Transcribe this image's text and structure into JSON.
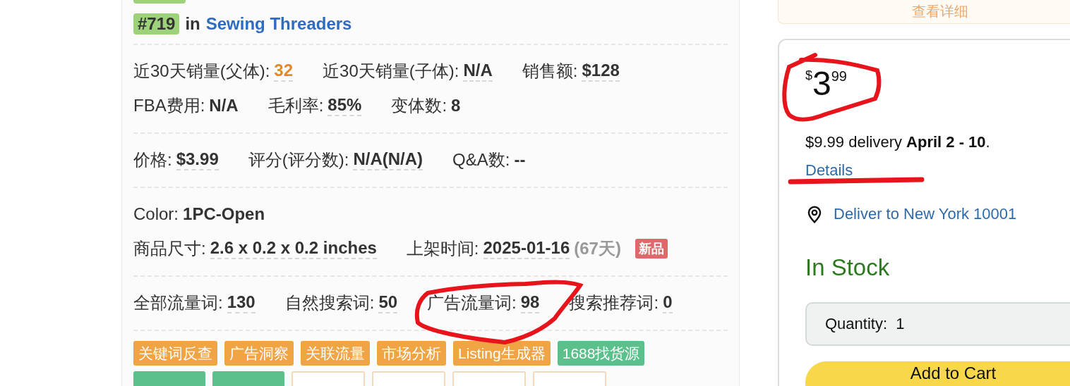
{
  "rank": {
    "badge": "#719",
    "connector": "in",
    "category": "Sewing Threaders"
  },
  "sections": [
    {
      "lines": [
        {
          "fields": [
            {
              "label": "近30天销量(父体):",
              "value": "32",
              "highlight": true,
              "underlined": true
            },
            {
              "label": "近30天销量(子体):",
              "value": "N/A",
              "highlight": false,
              "underlined": true
            },
            {
              "label": "销售额:",
              "value": "$128",
              "highlight": false,
              "underlined": true
            }
          ]
        },
        {
          "fields": [
            {
              "label": "FBA费用:",
              "value": "N/A",
              "highlight": false,
              "underlined": false
            },
            {
              "label": "毛利率:",
              "value": "85%",
              "highlight": false,
              "underlined": true
            },
            {
              "label": "变体数:",
              "value": "8",
              "highlight": false,
              "underlined": false
            }
          ]
        }
      ]
    },
    {
      "lines": [
        {
          "fields": [
            {
              "label": "价格:",
              "value": "$3.99",
              "highlight": false,
              "underlined": true
            },
            {
              "label": "评分(评分数):",
              "value": "N/A(N/A)",
              "highlight": false,
              "underlined": true
            },
            {
              "label": "Q&A数:",
              "value": "--",
              "highlight": false,
              "underlined": false
            }
          ]
        }
      ]
    },
    {
      "lines": [
        {
          "fields": [
            {
              "label": "Color:",
              "value": "1PC-Open",
              "highlight": false,
              "underlined": false
            }
          ]
        },
        {
          "fields": [
            {
              "label": "商品尺寸:",
              "value": "2.6 x 0.2 x 0.2 inches",
              "highlight": false,
              "underlined": true
            },
            {
              "label": "上架时间:",
              "value": "2025-01-16",
              "note": "(67天)",
              "badge": "新品",
              "highlight": false,
              "underlined": true
            }
          ]
        }
      ]
    },
    {
      "lines": [
        {
          "fields": [
            {
              "label": "全部流量词:",
              "value": "130",
              "highlight": false,
              "underlined": true
            },
            {
              "label": "自然搜索词:",
              "value": "50",
              "highlight": false,
              "underlined": true
            },
            {
              "label": "广告流量词:",
              "value": "98",
              "highlight": false,
              "underlined": true
            },
            {
              "label": "搜索推荐词:",
              "value": "0",
              "highlight": false,
              "underlined": true
            }
          ]
        }
      ]
    }
  ],
  "tools": [
    {
      "label": "关键词反查",
      "color": "#f0a444",
      "kind": "solid"
    },
    {
      "label": "广告洞察",
      "color": "#f0a444",
      "kind": "solid"
    },
    {
      "label": "关联流量",
      "color": "#f0a444",
      "kind": "solid"
    },
    {
      "label": "市场分析",
      "color": "#f0a444",
      "kind": "solid"
    },
    {
      "label": "Listing生成器",
      "color": "#f0a444",
      "kind": "solid"
    },
    {
      "label": "1688找货源",
      "color": "#5cc08c",
      "kind": "solid"
    }
  ],
  "tools_cut": [
    {
      "color": "#5cc08c",
      "kind": "solid"
    },
    {
      "color": "#5cc08c",
      "kind": "solid"
    },
    {
      "color": "#f3d9bd",
      "kind": "outline"
    },
    {
      "color": "#f3d9bd",
      "kind": "outline"
    },
    {
      "color": "#f3d9bd",
      "kind": "outline"
    },
    {
      "color": "#f3d9bd",
      "kind": "outline"
    }
  ],
  "detail_button": "查看详细",
  "buy_box": {
    "price": {
      "symbol": "$",
      "whole": "3",
      "fraction": "99"
    },
    "delivery": "$9.99 delivery **April 2 - 10**.",
    "details_link": "Details",
    "location": "Deliver to New York 10001",
    "stock": "In Stock",
    "quantity": {
      "label": "Quantity:",
      "value": "1"
    },
    "add_to_cart": "Add to Cart"
  }
}
